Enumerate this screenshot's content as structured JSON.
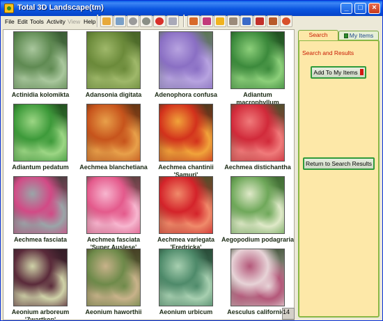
{
  "window": {
    "title": "Total 3D Landscape(tm)"
  },
  "menu": [
    {
      "label": "File",
      "enabled": true
    },
    {
      "label": "Edit",
      "enabled": true
    },
    {
      "label": "Tools",
      "enabled": true
    },
    {
      "label": "Activity",
      "enabled": true
    },
    {
      "label": "View",
      "enabled": false
    },
    {
      "label": "Help",
      "enabled": true
    }
  ],
  "toolbar_icons": [
    "open-icon",
    "save-icon",
    "tools-icon",
    "refresh-icon",
    "help-icon",
    "wizard-icon",
    "view-icon",
    "garden-icon",
    "light-icon",
    "object-icon",
    "shop-icon",
    "plant-icon",
    "house-icon",
    "zoom-icon"
  ],
  "plants": [
    {
      "name": "Actinidia kolomikta",
      "palette": [
        "#5f8a52",
        "#a9c79d",
        "#2f4f2c"
      ]
    },
    {
      "name": "Adansonia digitata",
      "palette": [
        "#6b8a3a",
        "#9fb86a",
        "#3e5a22"
      ]
    },
    {
      "name": "Adenophora confusa",
      "palette": [
        "#8a6fc4",
        "#b7a3e0",
        "#4e7a34"
      ]
    },
    {
      "name": "Adiantum macrophyllum",
      "palette": [
        "#3c8a3c",
        "#8ccf7a",
        "#1a3f1a"
      ]
    },
    {
      "name": "Adiantum pedatum",
      "palette": [
        "#3d9a3a",
        "#9cd684",
        "#1d3d1a"
      ]
    },
    {
      "name": "Aechmea blanchetiana",
      "palette": [
        "#c7541c",
        "#e8a04a",
        "#4a2d12"
      ]
    },
    {
      "name": "Aechmea chantinii 'Samuri'",
      "palette": [
        "#d3321c",
        "#f1a33a",
        "#2c3a1c"
      ]
    },
    {
      "name": "Aechmea distichantha",
      "palette": [
        "#d12a3a",
        "#f07a7a",
        "#2c5a2a"
      ]
    },
    {
      "name": "Aechmea fasciata",
      "palette": [
        "#d24a86",
        "#9aa5a8",
        "#2a3a2e"
      ]
    },
    {
      "name": "Aechmea fasciata 'Super Auslese'",
      "palette": [
        "#e45a8c",
        "#f7b6cf",
        "#3a3a2c"
      ]
    },
    {
      "name": "Aechmea variegata 'Fredricka'",
      "palette": [
        "#d4232a",
        "#f08a6a",
        "#2f5a2a"
      ]
    },
    {
      "name": "Aegopodium podagraria",
      "palette": [
        "#6fa85a",
        "#dfe9c8",
        "#345a2a"
      ]
    },
    {
      "name": "Aeonium arboreum 'Zwartkop'",
      "palette": [
        "#5a2a3a",
        "#cfd2a8",
        "#2a1a22"
      ]
    },
    {
      "name": "Aeonium haworthii",
      "palette": [
        "#6e8a4a",
        "#c8b28a",
        "#3a2a1a"
      ]
    },
    {
      "name": "Aeonium urbicum",
      "palette": [
        "#4e8a6a",
        "#a7cfb0",
        "#1f3a2a"
      ]
    },
    {
      "name": "Aesculus californica",
      "palette": [
        "#e7d3d7",
        "#b4587a",
        "#203a1a"
      ]
    }
  ],
  "scroll_corner_label": "14",
  "panel": {
    "tabs": [
      {
        "label": "Search",
        "active": true
      },
      {
        "label": "My Items",
        "active": false
      }
    ],
    "heading": "Search and Results",
    "add_button": "Add To My Items",
    "return_button": "Return to Search Results"
  }
}
